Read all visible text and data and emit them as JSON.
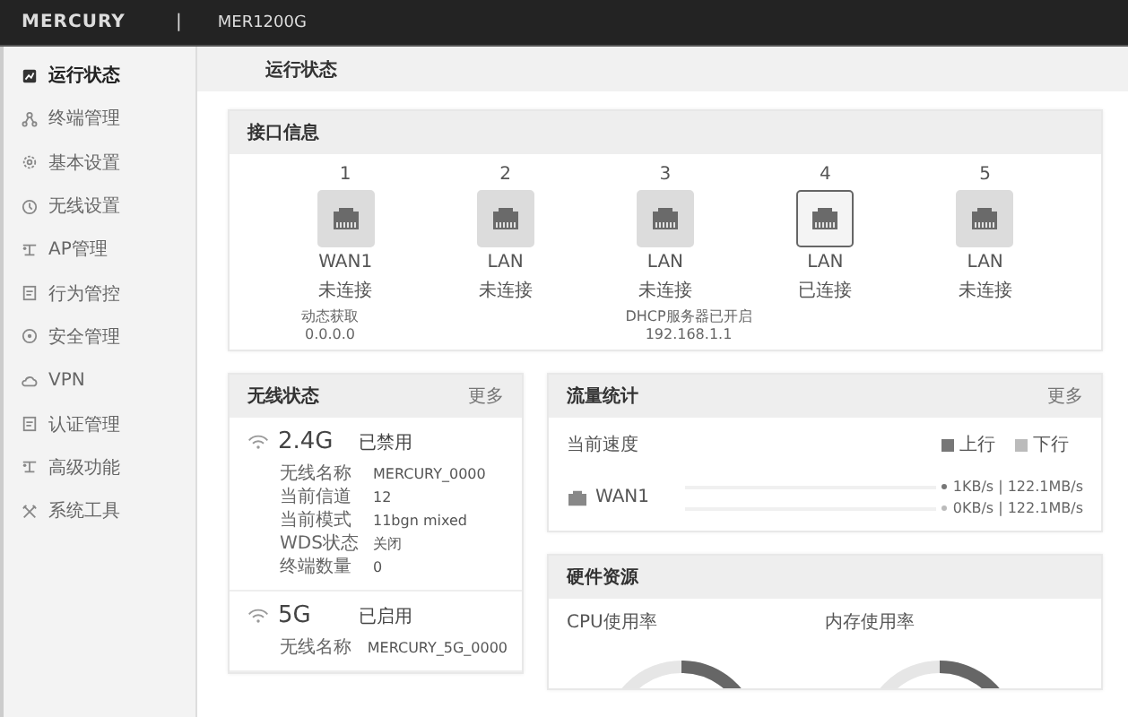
{
  "header": {
    "logo": "MERCURY",
    "separator": "|",
    "model": "MER1200G"
  },
  "sidebar": {
    "items": [
      {
        "label": "运行状态",
        "selected": true
      },
      {
        "label": "终端管理",
        "selected": false
      },
      {
        "label": "基本设置",
        "selected": false
      },
      {
        "label": "无线设置",
        "selected": false
      },
      {
        "label": "AP管理",
        "selected": false
      },
      {
        "label": "行为管控",
        "selected": false
      },
      {
        "label": "安全管理",
        "selected": false
      },
      {
        "label": "VPN",
        "selected": false
      },
      {
        "label": "认证管理",
        "selected": false
      },
      {
        "label": "高级功能",
        "selected": false
      },
      {
        "label": "系统工具",
        "selected": false
      }
    ]
  },
  "breadcrumb": "运行状态",
  "interfaces": {
    "title": "接口信息",
    "ports": [
      {
        "number": "1",
        "name": "WAN1",
        "status": "未连接",
        "connected": false
      },
      {
        "number": "2",
        "name": "LAN",
        "status": "未连接",
        "connected": false
      },
      {
        "number": "3",
        "name": "LAN",
        "status": "未连接",
        "connected": false
      },
      {
        "number": "4",
        "name": "LAN",
        "status": "已连接",
        "connected": true
      },
      {
        "number": "5",
        "name": "LAN",
        "status": "未连接",
        "connected": false
      }
    ],
    "wan_info": [
      "动态获取",
      "0.0.0.0"
    ],
    "lan_info": [
      "DHCP服务器已开启",
      "192.168.1.1"
    ]
  },
  "wireless": {
    "title": "无线状态",
    "more": "更多",
    "bands": [
      {
        "band": "2.4G",
        "status": "已禁用",
        "rows": [
          {
            "label": "无线名称",
            "value": "MERCURY_0000"
          },
          {
            "label": "当前信道",
            "value": "12"
          },
          {
            "label": "当前模式",
            "value": "11bgn mixed"
          },
          {
            "label": "WDS状态",
            "value": "关闭"
          },
          {
            "label": "终端数量",
            "value": "0"
          }
        ]
      },
      {
        "band": "5G",
        "status": "已启用",
        "rows": [
          {
            "label": "无线名称",
            "value": "MERCURY_5G_0000"
          }
        ]
      }
    ]
  },
  "traffic": {
    "title": "流量统计",
    "more": "更多",
    "speed_label": "当前速度",
    "legend": [
      {
        "label": "上行",
        "color": "#777777"
      },
      {
        "label": "下行",
        "color": "#bbbbbb"
      }
    ],
    "interface": "WAN1",
    "readings": [
      {
        "text": "1KB/s | 122.1MB/s",
        "color": "#777777"
      },
      {
        "text": "0KB/s | 122.1MB/s",
        "color": "#bbbbbb"
      }
    ]
  },
  "hardware": {
    "title": "硬件资源",
    "gauges": [
      {
        "label": "CPU使用率"
      },
      {
        "label": "内存使用率"
      }
    ]
  }
}
